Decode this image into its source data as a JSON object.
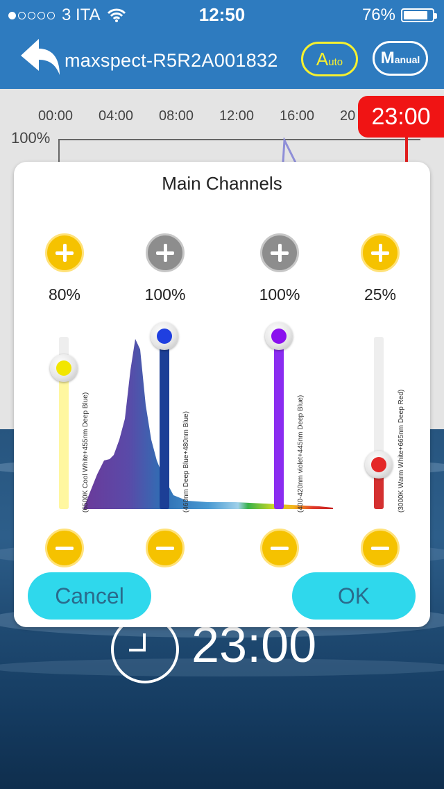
{
  "status": {
    "carrier": "3 ITA",
    "time": "12:50",
    "battery": "76%",
    "signal_bars_filled": 1,
    "signal_bars_total": 5,
    "icons": [
      "wifi-icon",
      "battery-icon"
    ]
  },
  "nav": {
    "title": "maxspect-R5R2A001832",
    "auto_label_big": "A",
    "auto_label_small": "uto",
    "manual_label_big": "M",
    "manual_label_small": "anual"
  },
  "schedule": {
    "ticks": [
      "00:00",
      "04:00",
      "08:00",
      "12:00",
      "16:00",
      "20"
    ],
    "y_max_label": "100%",
    "time_badge": "23:00"
  },
  "clock": {
    "time": "23:00"
  },
  "dialog": {
    "title": "Main Channels",
    "channels": [
      {
        "percent": "80%",
        "level": 0.8,
        "label": "(6500K Cool White+455nm Deep Blue)",
        "color": "#f2e600",
        "track": "#fff7a0",
        "plus_color": "#f5c200"
      },
      {
        "percent": "100%",
        "level": 1.0,
        "label": "(460nm Deep Blue+480nm Blue)",
        "color": "#1f3fe0",
        "track": "#1c3f96",
        "plus_color": "#8d8d8d"
      },
      {
        "percent": "100%",
        "level": 1.0,
        "label": "(400-420nm violet+445nm Deep Blue)",
        "color": "#8a10ee",
        "track": "#8a2cf0",
        "plus_color": "#8d8d8d"
      },
      {
        "percent": "25%",
        "level": 0.25,
        "label": "(3000K Warm White+665nm Deep Red)",
        "color": "#e42828",
        "track": "#d43030",
        "plus_color": "#f5c200"
      }
    ],
    "cancel_label": "Cancel",
    "ok_label": "OK"
  }
}
